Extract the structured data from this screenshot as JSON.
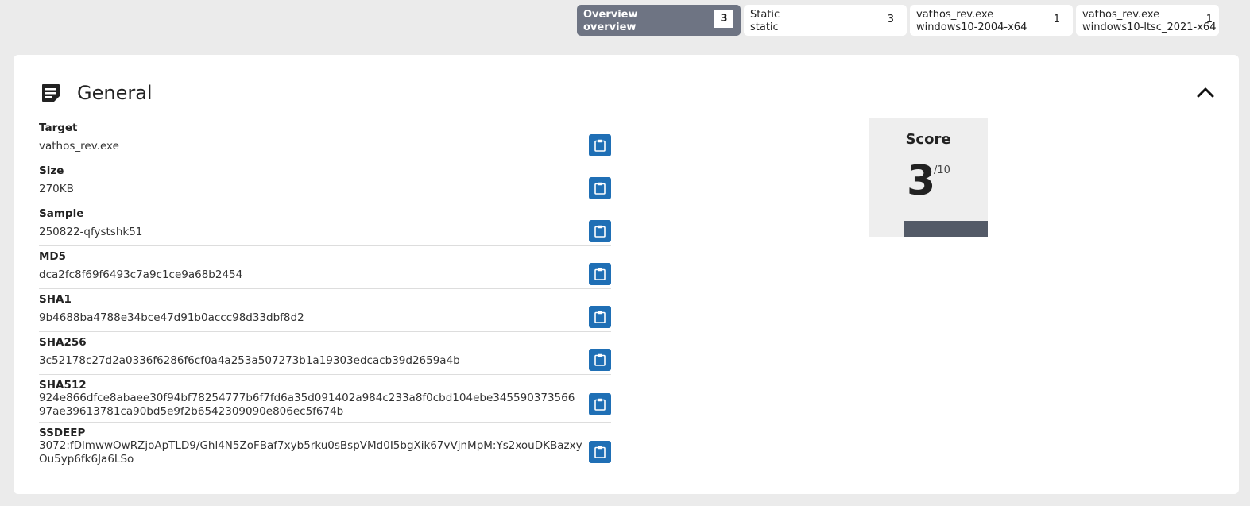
{
  "tabs": [
    {
      "line1": "Overview",
      "line2": "overview",
      "count": "3",
      "active": true
    },
    {
      "line1": "Static",
      "line2": "static",
      "count": "3",
      "active": false
    },
    {
      "line1": "vathos_rev.exe",
      "line2": "windows10-2004-x64",
      "count": "1",
      "active": false
    },
    {
      "line1": "vathos_rev.exe",
      "line2": "windows10-ltsc_2021-x64",
      "count": "1",
      "active": false
    }
  ],
  "general": {
    "title": "General",
    "icon": "document-note-icon",
    "collapse_icon": "chevron-up-icon",
    "fields": [
      {
        "label": "Target",
        "value": "vathos_rev.exe"
      },
      {
        "label": "Size",
        "value": "270KB"
      },
      {
        "label": "Sample",
        "value": "250822-qfystshk51"
      },
      {
        "label": "MD5",
        "value": "dca2fc8f69f6493c7a9c1ce9a68b2454"
      },
      {
        "label": "SHA1",
        "value": "9b4688ba4788e34bce47d91b0accc98d33dbf8d2"
      },
      {
        "label": "SHA256",
        "value": "3c52178c27d2a0336f6286f6cf0a4a253a507273b1a19303edcacb39d2659a4b"
      },
      {
        "label": "SHA512",
        "value": "924e866dfce8abaee30f94bf78254777b6f7fd6a35d091402a984c233a8f0cbd104ebe345590373566\n97ae39613781ca90bd5e9f2b6542309090e806ec5f674b"
      },
      {
        "label": "SSDEEP",
        "value": "3072:fDlmwwOwRZjoApTLD9/Ghl4N5ZoFBaf7xyb5rku0sBspVMd0I5bgXik67vVjnMpM:Ys2xouDKBazxy\nOu5yp6fk6Ja6LSo"
      }
    ],
    "copy_icon": "clipboard-icon"
  },
  "score": {
    "label": "Score",
    "value": "3",
    "max": "/10",
    "fraction": 0.3
  },
  "colors": {
    "accent": "#1f6fb5",
    "active_tab": "#6e7483",
    "score_bar": "#535a67"
  }
}
